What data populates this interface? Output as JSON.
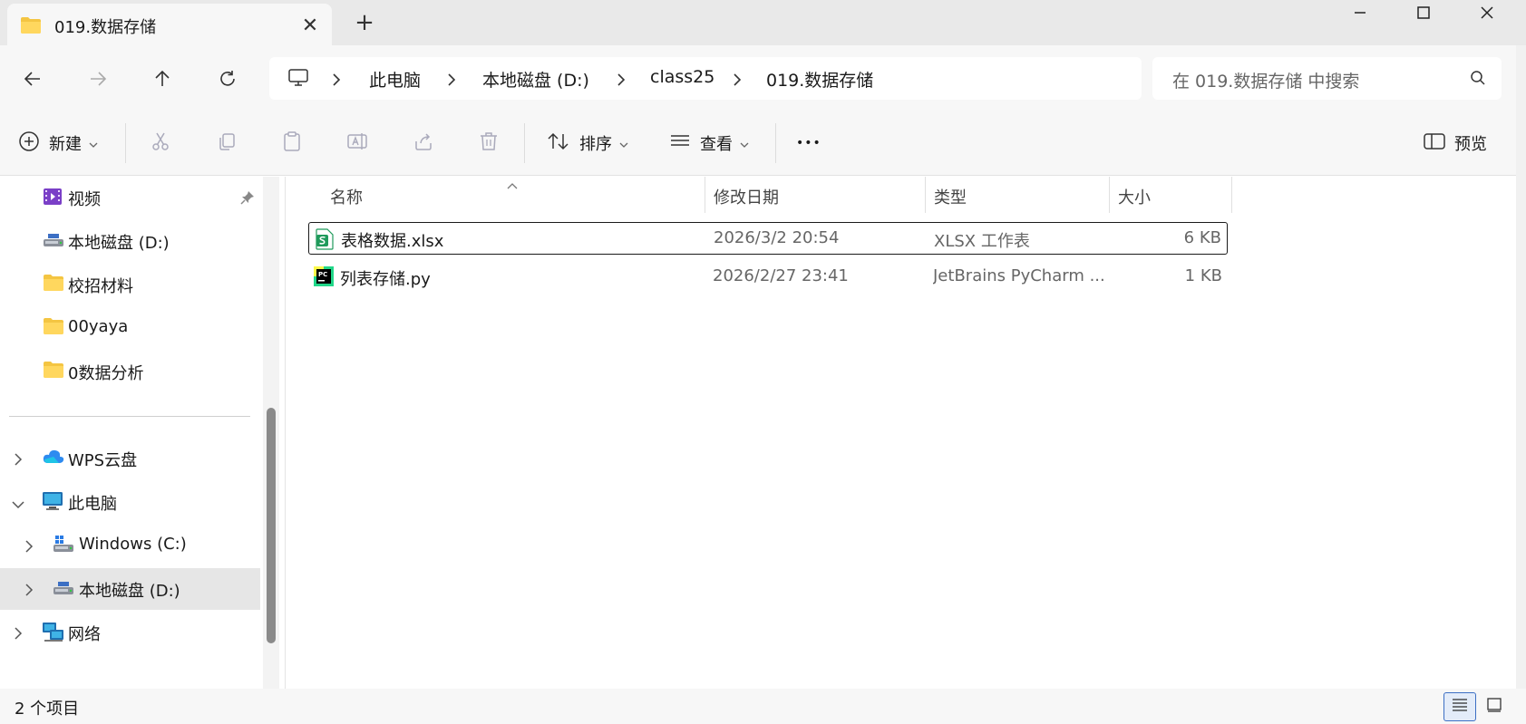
{
  "tab": {
    "title": "019.数据存储",
    "new_tab": "+"
  },
  "addressbar": {
    "crumbs": [
      "此电脑",
      "本地磁盘 (D:)",
      "class25",
      "019.数据存储"
    ]
  },
  "search": {
    "placeholder": "在 019.数据存储 中搜索"
  },
  "toolbar": {
    "new_label": "新建",
    "sort_label": "排序",
    "view_label": "查看",
    "more_label": "•••",
    "preview_label": "预览"
  },
  "sidebar": {
    "items": [
      {
        "label": "视频",
        "icon": "video-icon"
      },
      {
        "label": "本地磁盘 (D:)",
        "icon": "drive-icon"
      },
      {
        "label": "校招材料",
        "icon": "folder-icon"
      },
      {
        "label": "00yaya",
        "icon": "folder-icon"
      },
      {
        "label": "0数据分析",
        "icon": "folder-icon"
      },
      {
        "label": "WPS云盘",
        "icon": "cloud-icon"
      },
      {
        "label": "此电脑",
        "icon": "computer-icon"
      },
      {
        "label": "Windows (C:)",
        "icon": "windows-drive-icon"
      },
      {
        "label": "本地磁盘 (D:)",
        "icon": "drive-icon"
      },
      {
        "label": "网络",
        "icon": "network-icon"
      }
    ]
  },
  "columns": {
    "name": "名称",
    "date": "修改日期",
    "type": "类型",
    "size": "大小"
  },
  "files": [
    {
      "name": "表格数据.xlsx",
      "date": "2026/3/2 20:54",
      "type": "XLSX 工作表",
      "size": "6 KB",
      "icon": "xlsx-icon"
    },
    {
      "name": "列表存储.py",
      "date": "2026/2/27 23:41",
      "type": "JetBrains PyCharm ...",
      "size": "1 KB",
      "icon": "pycharm-icon"
    }
  ],
  "status": {
    "count": "2 个项目"
  },
  "colors": {
    "folder": "#f4c542",
    "accent": "#3c6fc4",
    "selected_bg": "#e6e6e6"
  }
}
